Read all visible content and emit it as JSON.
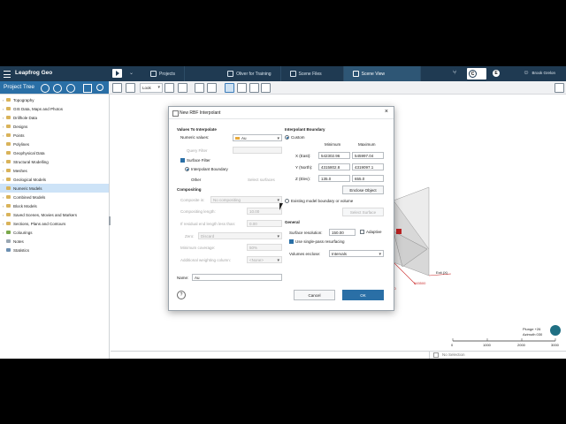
{
  "window": {
    "app_title": "Leapfrog Geo"
  },
  "tabs": [
    {
      "label": "Projects",
      "active": false
    },
    {
      "label": "Oliver for Training",
      "active": false
    },
    {
      "label": "Scene Files",
      "active": false
    },
    {
      "label": "Scene View",
      "active": true
    }
  ],
  "user": {
    "initial": "E",
    "name": "Brook Grelon"
  },
  "toolbar": {
    "look_label": "Look"
  },
  "project_tree": {
    "header": "Project Tree",
    "items": [
      {
        "label": "Topography"
      },
      {
        "label": "GIS Data, Maps and Photos"
      },
      {
        "label": "Drillhole Data"
      },
      {
        "label": "Designs"
      },
      {
        "label": "Points"
      },
      {
        "label": "Polylines"
      },
      {
        "label": "Geophysical Data"
      },
      {
        "label": "Structural Modelling"
      },
      {
        "label": "Meshes"
      },
      {
        "label": "Geological Models"
      },
      {
        "label": "Numeric Models",
        "selected": true
      },
      {
        "label": "Combined Models"
      },
      {
        "label": "Block Models"
      },
      {
        "label": "Saved Scenes, Movies and Markers"
      },
      {
        "label": "Sections, Plans and Contours"
      },
      {
        "label": "Colourings"
      },
      {
        "label": "Notes"
      },
      {
        "label": "Statistics"
      }
    ]
  },
  "scene": {
    "labels": {
      "exit": "Exit (X)",
      "x_label": "545500",
      "y_label": "500"
    },
    "scale": {
      "ticks": [
        "0",
        "1000",
        "2000",
        "3000"
      ]
    },
    "orientation": {
      "plunge": "Plunge +26",
      "azimuth": "Azimuth 030"
    },
    "selection": "No Selection"
  },
  "dialog": {
    "title": "New RBF Interpolant",
    "values_section": "Values To Interpolate",
    "numeric_values_label": "Numeric values:",
    "numeric_values_value": "Au",
    "query_filter_label": "Query Filter",
    "surface_filter_label": "Surface Filter",
    "surface_filter_checked": true,
    "boundary_option_label": "Interpolant Boundary",
    "other_label": "Other",
    "select_surfaces_label": "Select surfaces",
    "compositing_section": "Compositing",
    "compositing": {
      "composite_label": "Composite in:",
      "composite_value": "No compositing",
      "length_label": "Compositing length:",
      "length_value": "10.00",
      "residual_label": "If residual end length less than:",
      "residual_value": "0.00",
      "mode_label": "Zero:",
      "mode_value": "Discard",
      "min_coverage_label": "Minimum coverage:",
      "min_coverage_value": "50%",
      "weighting_label": "Additional weighting column:",
      "weighting_value": "<None>"
    },
    "name_label": "Name:",
    "name_value": "Au",
    "boundary_section": "Interpolant Boundary",
    "custom_label": "Custom",
    "minimum_header": "Minimum",
    "maximum_header": "Maximum",
    "axes": [
      {
        "label": "X (East):",
        "min": "542302.96",
        "max": "545997.04"
      },
      {
        "label": "Y (North):",
        "min": "4315802.8",
        "max": "4319097.1"
      },
      {
        "label": "Z (Elev):",
        "min": "135.0",
        "max": "655.0"
      }
    ],
    "enclose_object_label": "Enclose Object",
    "existing_boundary_label": "Existing model boundary or volume",
    "select_surface_label": "Select Surface",
    "general_section": "General",
    "surface_resolution_label": "Surface resolution:",
    "surface_resolution_value": "150.00",
    "adaptive_label": "Adaptive",
    "single_pass_label": "Use single-pass resurfacing",
    "single_pass_checked": true,
    "volumes_enclose_label": "Volumes enclose:",
    "volumes_enclose_value": "Intervals",
    "cancel_label": "Cancel",
    "ok_label": "OK",
    "help_icon": "?"
  },
  "colors": {
    "title_bar": "#1f3a52",
    "accent": "#2a6fa6",
    "selected_row": "#cde3f7"
  }
}
